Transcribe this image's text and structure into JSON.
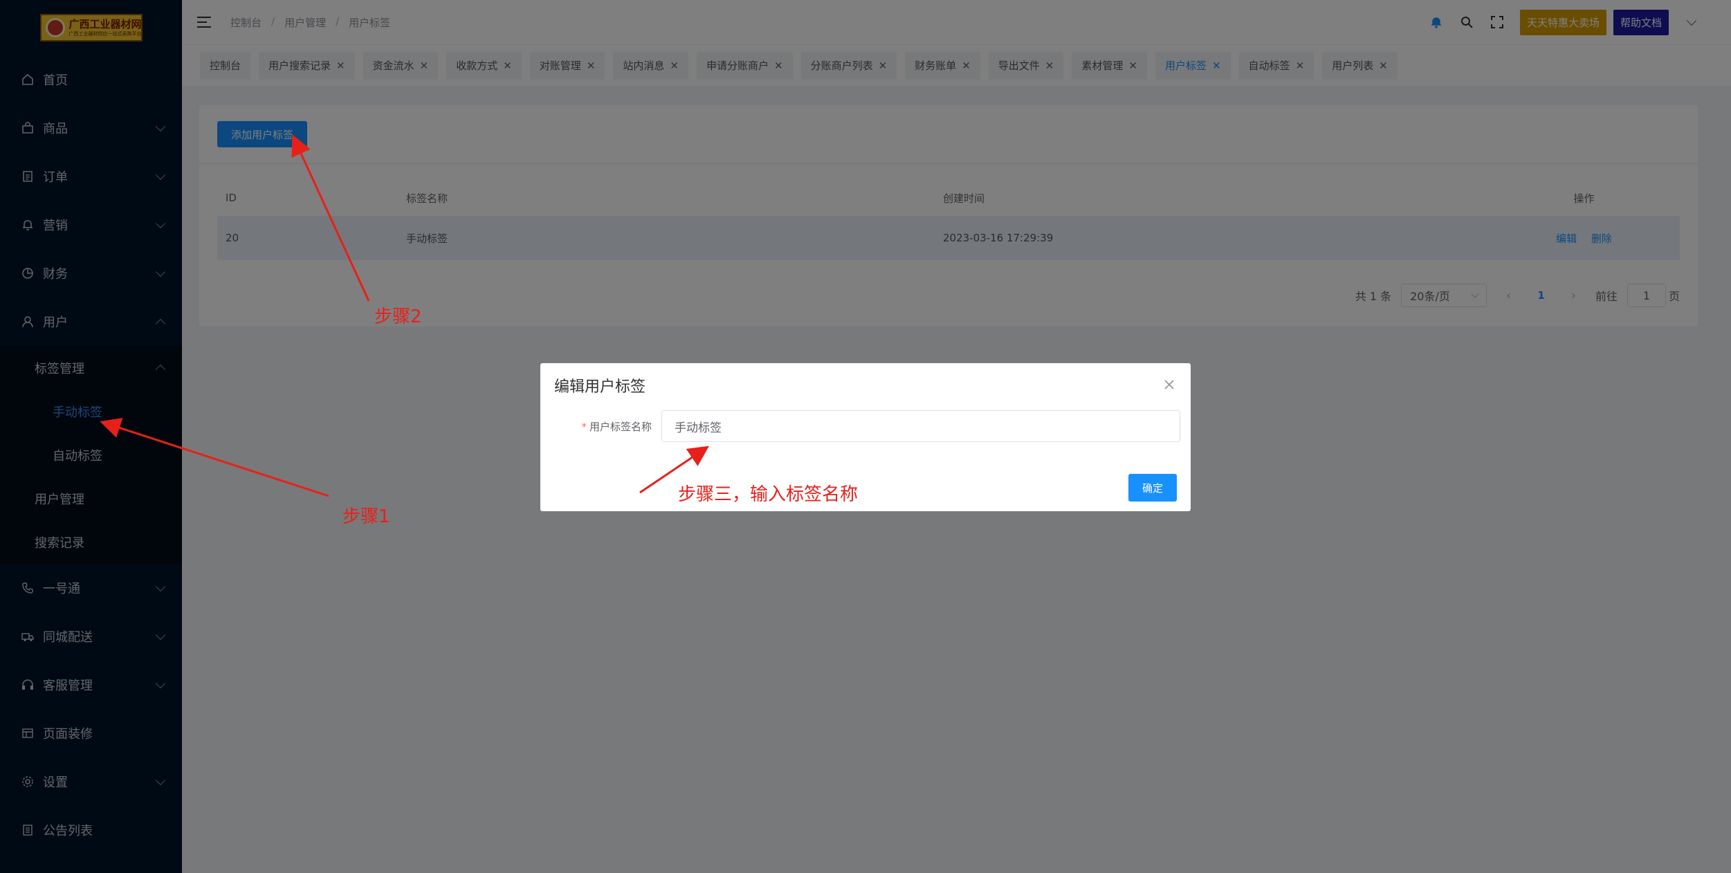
{
  "logo": {
    "title": "广西工业器材网",
    "subtitle": "广西工业器材供应一站式采购平台"
  },
  "sidebar": {
    "items": [
      {
        "label": "首页",
        "icon": "home-icon"
      },
      {
        "label": "商品",
        "icon": "bag-icon"
      },
      {
        "label": "订单",
        "icon": "document-icon"
      },
      {
        "label": "营销",
        "icon": "bell-icon"
      },
      {
        "label": "财务",
        "icon": "pie-chart-icon"
      },
      {
        "label": "用户",
        "icon": "user-icon"
      }
    ],
    "user_sub": {
      "tag_management": "标签管理",
      "manual_tags": "手动标签",
      "auto_tags": "自动标签",
      "user_management": "用户管理",
      "search_records": "搜索记录"
    },
    "items_after": [
      {
        "label": "一号通",
        "icon": "phone-icon"
      },
      {
        "label": "同城配送",
        "icon": "truck-icon"
      },
      {
        "label": "客服管理",
        "icon": "headset-icon"
      },
      {
        "label": "页面装修",
        "icon": "layout-icon"
      },
      {
        "label": "设置",
        "icon": "gear-icon"
      },
      {
        "label": "公告列表",
        "icon": "list-icon"
      }
    ]
  },
  "header": {
    "breadcrumb": [
      "控制台",
      "用户管理",
      "用户标签"
    ],
    "promo_button": "天天特惠大卖场",
    "help_button": "帮助文档"
  },
  "tabs": [
    {
      "label": "控制台",
      "closable": false
    },
    {
      "label": "用户搜索记录",
      "closable": true
    },
    {
      "label": "资金流水",
      "closable": true
    },
    {
      "label": "收款方式",
      "closable": true
    },
    {
      "label": "对账管理",
      "closable": true
    },
    {
      "label": "站内消息",
      "closable": true
    },
    {
      "label": "申请分账商户",
      "closable": true
    },
    {
      "label": "分账商户列表",
      "closable": true
    },
    {
      "label": "财务账单",
      "closable": true
    },
    {
      "label": "导出文件",
      "closable": true
    },
    {
      "label": "素材管理",
      "closable": true
    },
    {
      "label": "用户标签",
      "closable": true,
      "active": true
    },
    {
      "label": "自动标签",
      "closable": true
    },
    {
      "label": "用户列表",
      "closable": true
    }
  ],
  "main": {
    "add_button": "添加用户标签",
    "table": {
      "headers": [
        "ID",
        "标签名称",
        "创建时间",
        "操作"
      ],
      "rows": [
        {
          "id": "20",
          "name": "手动标签",
          "created": "2023-03-16 17:29:39",
          "edit": "编辑",
          "delete": "删除"
        }
      ]
    },
    "pagination": {
      "total": "共 1 条",
      "page_size": "20条/页",
      "current": "1",
      "goto_prefix": "前往",
      "goto_value": "1",
      "goto_suffix": "页"
    }
  },
  "dialog": {
    "title": "编辑用户标签",
    "field_label": "用户标签名称",
    "field_value": "手动标签",
    "ok_button": "确定"
  },
  "annotations": {
    "step1": "步骤1",
    "step2": "步骤2",
    "step3": "步骤三，输入标签名称"
  },
  "colors": {
    "accent": "#1890ff",
    "sidebar_bg": "#001529",
    "annotation": "#e8201a"
  }
}
